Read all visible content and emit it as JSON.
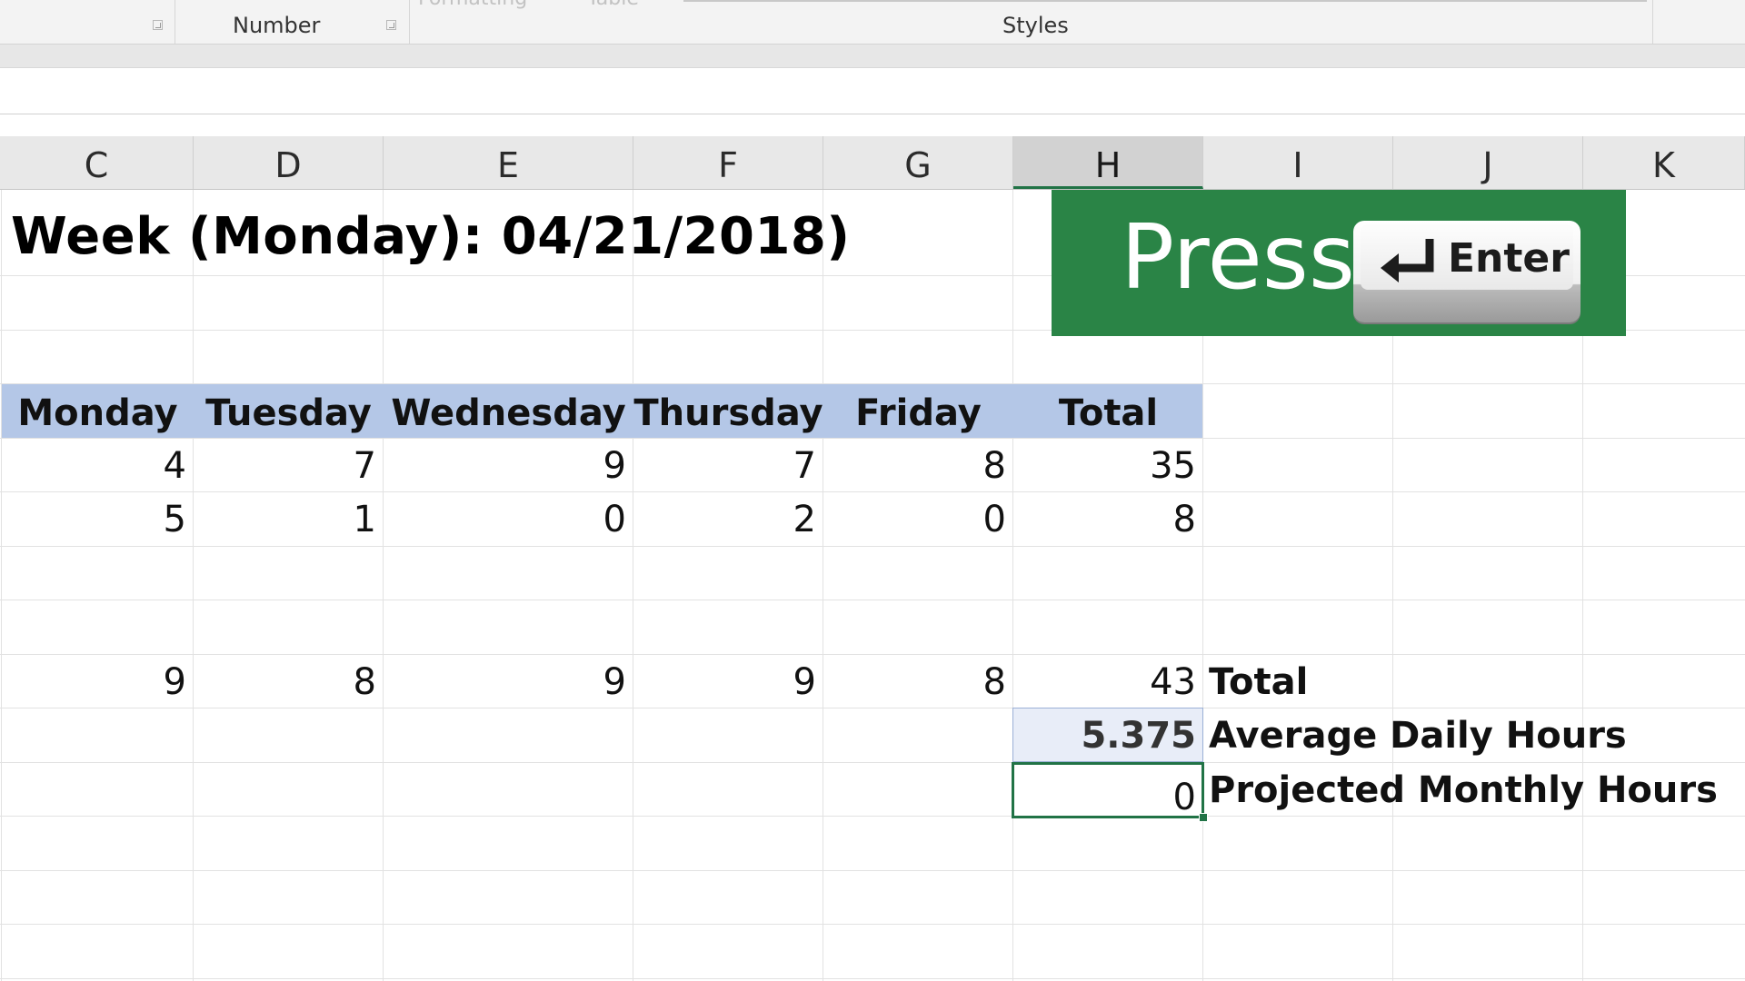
{
  "ribbon": {
    "faded_labels": [
      "Formatting",
      "Table"
    ],
    "groups": [
      "Number",
      "Styles"
    ]
  },
  "columns": [
    "C",
    "D",
    "E",
    "F",
    "G",
    "H",
    "I",
    "J",
    "K"
  ],
  "selected_column": "H",
  "sheet": {
    "title": "Week (Monday): 04/21/2018)",
    "table_headers": [
      "Monday",
      "Tuesday",
      "Wednesday",
      "Thursday",
      "Friday",
      "Total"
    ],
    "rows": [
      [
        "4",
        "7",
        "9",
        "7",
        "8",
        "35"
      ],
      [
        "5",
        "1",
        "0",
        "2",
        "0",
        "8"
      ]
    ],
    "totals_row": [
      "9",
      "8",
      "9",
      "9",
      "8",
      "43"
    ],
    "totals_label": "Total",
    "average_value": "5.375",
    "average_label": "Average Daily Hours",
    "projected_value": "0",
    "projected_label": "Projected Monthly Hours"
  },
  "overlay": {
    "press_text": "Press",
    "key_label": "Enter",
    "banner_color": "#2a8446"
  },
  "colors": {
    "header_fill": "#b4c7e7",
    "selection_border": "#217346"
  }
}
